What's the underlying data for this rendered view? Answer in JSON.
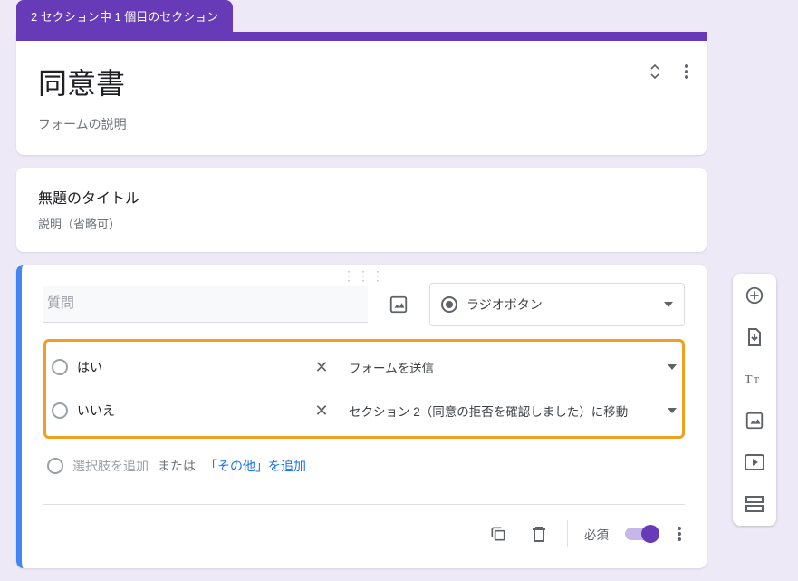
{
  "section_tab": "2 セクション中 1 個目のセクション",
  "header": {
    "title": "同意書",
    "description": "フォームの説明"
  },
  "title_block": {
    "title": "無題のタイトル",
    "description": "説明（省略可）"
  },
  "question": {
    "placeholder": "質問",
    "type_label": "ラジオボタン",
    "options": [
      {
        "label": "はい",
        "action": "フォームを送信"
      },
      {
        "label": "いいえ",
        "action": "セクション 2（同意の拒否を確認しました）に移動"
      }
    ],
    "add_option": "選択肢を追加",
    "add_sep": "または",
    "add_other": "「その他」を追加",
    "required_label": "必須"
  }
}
